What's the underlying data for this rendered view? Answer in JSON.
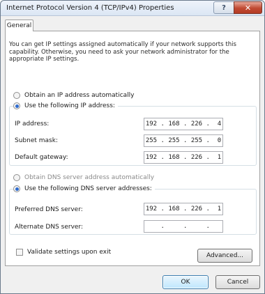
{
  "window": {
    "title": "Internet Protocol Version 4 (TCP/IPv4) Properties",
    "help_glyph": "?",
    "close_glyph": "✕"
  },
  "tabs": [
    {
      "label": "General",
      "selected": true
    }
  ],
  "description": "You can get IP settings assigned automatically if your network supports this capability. Otherwise, you need to ask your network administrator for the appropriate IP settings.",
  "ip_section": {
    "auto_option": {
      "label": "Obtain an IP address automatically",
      "selected": false
    },
    "manual_option": {
      "label": "Use the following IP address:",
      "selected": true
    },
    "fields": [
      {
        "label": "IP address:",
        "value": "192 . 168 . 226 .  4"
      },
      {
        "label": "Subnet mask:",
        "value": "255 . 255 . 255 .  0"
      },
      {
        "label": "Default gateway:",
        "value": "192 . 168 . 226 .  1"
      }
    ]
  },
  "dns_section": {
    "auto_option": {
      "label": "Obtain DNS server address automatically",
      "selected": false
    },
    "manual_option": {
      "label": "Use the following DNS server addresses:",
      "selected": true
    },
    "fields": [
      {
        "label": "Preferred DNS server:",
        "value": "192 . 168 . 226 .  1"
      },
      {
        "label": "Alternate DNS server:",
        "value": "    .     .     .   "
      }
    ]
  },
  "validate": {
    "label": "Validate settings upon exit",
    "checked": false
  },
  "buttons": {
    "advanced": "Advanced...",
    "ok": "OK",
    "cancel": "Cancel"
  },
  "colors": {
    "accent": "#2d6bcf",
    "close": "#c14a32"
  }
}
